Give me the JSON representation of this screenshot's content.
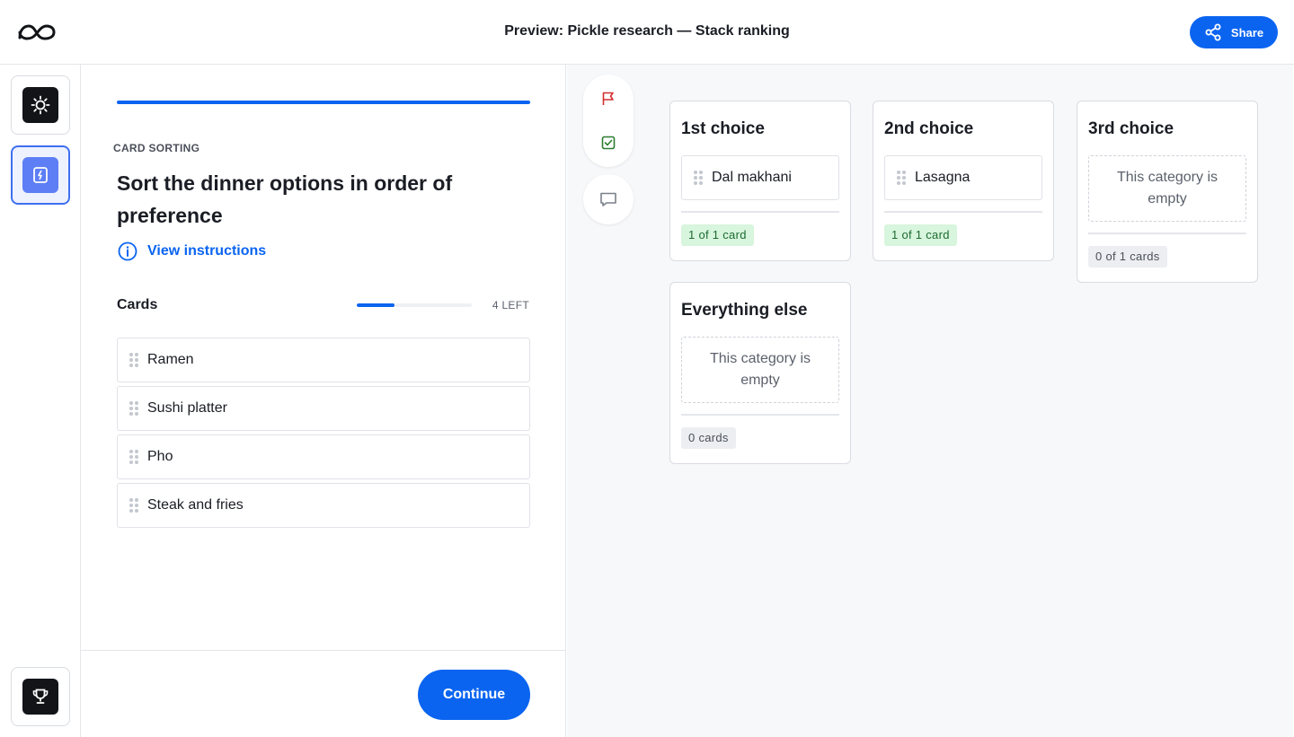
{
  "header": {
    "title": "Preview: Pickle research — Stack ranking",
    "share_label": "Share"
  },
  "rail": {
    "items": [
      {
        "icon": "sun-gear-icon",
        "state": "default"
      },
      {
        "icon": "card-sort-icon",
        "state": "active"
      },
      {
        "icon": "trophy-icon",
        "state": "default"
      }
    ]
  },
  "task": {
    "eyebrow": "CARD SORTING",
    "title": "Sort the dinner options in order of preference",
    "instructions_label": "View instructions",
    "cards_label": "Cards",
    "cards_left": "4 LEFT",
    "cards_progress": 0.33,
    "cards": [
      "Ramen",
      "Sushi platter",
      "Pho",
      "Steak and fries"
    ],
    "continue_label": "Continue"
  },
  "board": {
    "tools": [
      "flag-icon",
      "checkbox-icon",
      "comment-icon"
    ],
    "categories": [
      {
        "title": "1st choice",
        "cards": [
          "Dal makhani"
        ],
        "count_label": "1 of 1 card",
        "status": "complete"
      },
      {
        "title": "2nd choice",
        "cards": [
          "Lasagna"
        ],
        "count_label": "1 of 1 card",
        "status": "complete"
      },
      {
        "title": "3rd choice",
        "cards": [],
        "empty_label": "This category is empty",
        "count_label": "0 of 1 cards",
        "status": "empty"
      },
      {
        "title": "Everything else",
        "cards": [],
        "empty_label": "This category is empty",
        "count_label": "0 cards",
        "status": "empty"
      }
    ]
  },
  "colors": {
    "accent": "#0a64f0",
    "success_bg": "#d8f5dd",
    "success_text": "#1d6b30",
    "flag": "#d32f2f",
    "check": "#2e7d32"
  }
}
